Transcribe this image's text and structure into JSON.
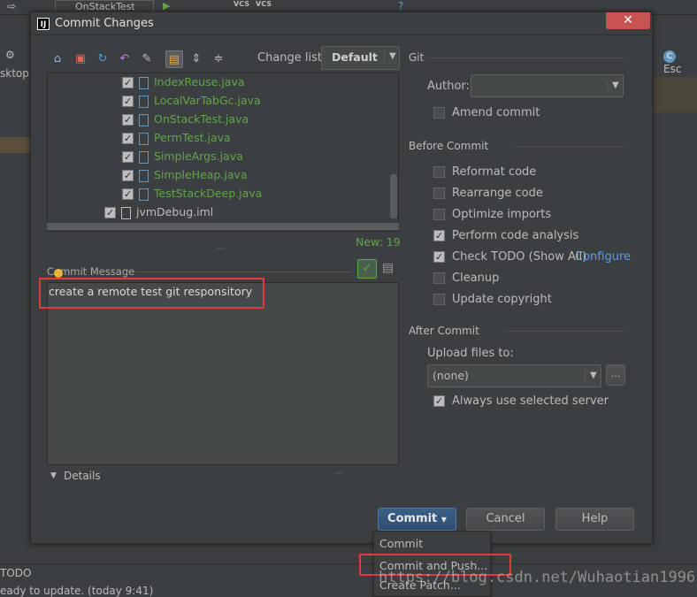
{
  "ide": {
    "run_config": "OnStackTest",
    "left_label": "sktop",
    "right_tab": "Esc",
    "status_todo": "TODO",
    "status_message": "eady to update. (today 9:41)"
  },
  "dialog": {
    "title": "Commit Changes",
    "logo_text": "IJ",
    "close": "✕",
    "changelist_label": "Change list:",
    "changelist_value": "Default",
    "files": [
      {
        "name": "IndexReuse.java",
        "checked": true
      },
      {
        "name": "LocalVarTabGc.java",
        "checked": true
      },
      {
        "name": "OnStackTest.java",
        "checked": true
      },
      {
        "name": "PermTest.java",
        "checked": true
      },
      {
        "name": "SimpleArgs.java",
        "checked": true
      },
      {
        "name": "SimpleHeap.java",
        "checked": true
      },
      {
        "name": "TestStackDeep.java",
        "checked": true
      },
      {
        "name": "jvmDebug.iml",
        "checked": true
      }
    ],
    "new_count": "New: 19",
    "commit_message_label": "Commit Message",
    "commit_message": "create a remote test git responsitory",
    "details_label": "Details",
    "git": {
      "section": "Git",
      "author_label": "Author:",
      "author_value": "",
      "amend": "Amend commit"
    },
    "before_commit": {
      "section": "Before Commit",
      "options": [
        {
          "label": "Reformat code",
          "checked": false
        },
        {
          "label": "Rearrange code",
          "checked": false
        },
        {
          "label": "Optimize imports",
          "checked": false
        },
        {
          "label": "Perform code analysis",
          "checked": true
        },
        {
          "label": "Check TODO (Show All)",
          "checked": true
        },
        {
          "label": "Cleanup",
          "checked": false
        },
        {
          "label": "Update copyright",
          "checked": false
        }
      ],
      "configure_link": "Configure"
    },
    "after_commit": {
      "section": "After Commit",
      "upload_label": "Upload files to:",
      "upload_value": "(none)",
      "browse": "...",
      "always_use": "Always use selected server"
    },
    "buttons": {
      "commit": "Commit",
      "cancel": "Cancel",
      "help": "Help"
    },
    "commit_menu": {
      "items": [
        "Commit",
        "Commit and Push...",
        "Create Patch..."
      ]
    }
  },
  "watermark": "https://blog.csdn.net/Wuhaotian1996",
  "colors": {
    "highlight_box": "#e03a3a",
    "file_text": "#62a548",
    "link": "#589df6",
    "primary_button": "#365880"
  }
}
